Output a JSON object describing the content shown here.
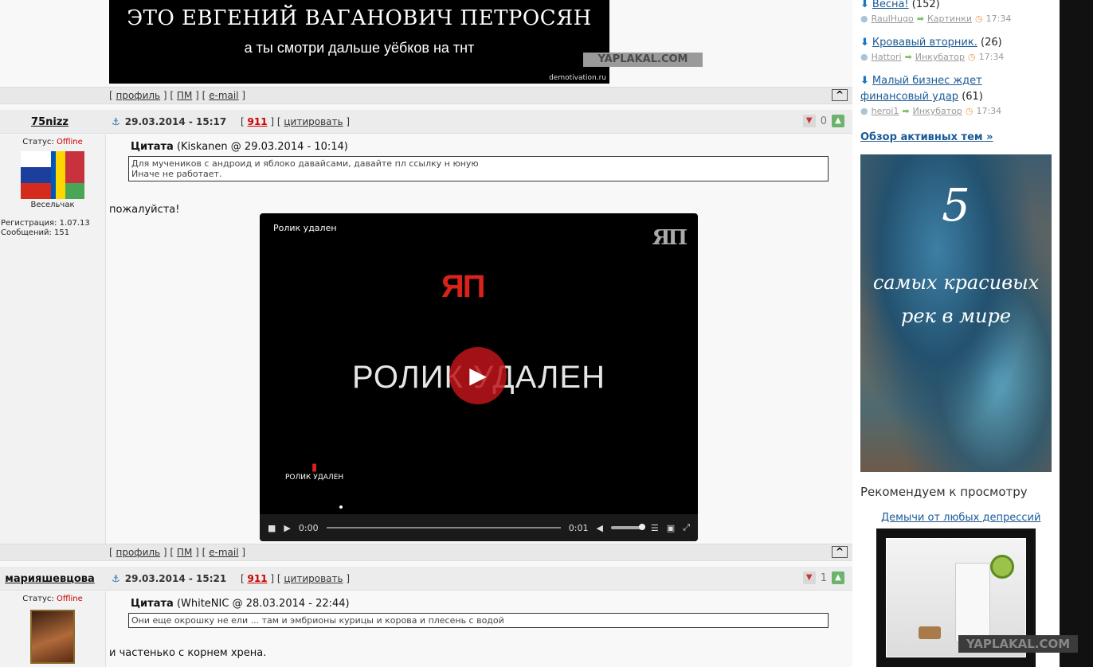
{
  "demotivator": {
    "line1": "ЭТО ЕВГЕНИЙ ВАГАНОВИЧ ПЕТРОСЯН",
    "line2": "а ты смотри дальше уёбков на тнт",
    "watermark": "YAPLAKAL.COM",
    "source": "demotivation.ru"
  },
  "post_links": {
    "profile": "профиль",
    "pm": "ПМ",
    "email": "e-mail",
    "top": "^"
  },
  "posts": [
    {
      "nick": "75nizz",
      "anchor": "⚓",
      "date": "29.03.2014 - 15:17",
      "rating": "911",
      "quote_action": "цитировать",
      "votes": "0",
      "status_label": "Статус:",
      "status": "Offline",
      "rank": "Весельчак",
      "reg": "Регистрация: 1.07.13",
      "messages": "Сообщений: 151",
      "quote_title": "Цитата",
      "quote_src": "(Kiskanen @ 29.03.2014 - 10:14)",
      "quote_line1": "Для мучеников с андроид и яблоко давайсами, давайте пл ссылку н юную",
      "quote_line2": "Иначе не работает.",
      "text": "пожалуйста!"
    },
    {
      "nick": "марияшевцова",
      "anchor": "⚓",
      "date": "29.03.2014 - 15:21",
      "rating": "911",
      "quote_action": "цитировать",
      "votes": "1",
      "status_label": "Статус:",
      "status": "Offline",
      "quote_title": "Цитата",
      "quote_src": "(WhiteNIC @ 28.03.2014 - 22:44)",
      "quote_line1": "Они еще окрошку не ели ... там и эмбрионы курицы и корова и плесень с водой",
      "text": "и частенько с корнем хрена."
    }
  ],
  "video": {
    "title": "Ролик удален",
    "corner_logo": "ЯП",
    "logo": "ЯП",
    "big_text": "РОЛИК УДАЛЕН",
    "small_caption": "РОЛИК УДАЛЕН",
    "time_current": "0:00",
    "time_total": "0:01"
  },
  "sidebar": {
    "topics": [
      {
        "title": "Весна!",
        "count": "(152)",
        "user": "RaulHugo",
        "section": "Картинки",
        "time": "17:34"
      },
      {
        "title": "Кровавый вторник.",
        "count": "(26)",
        "user": "Hattori",
        "section": "Инкубатор",
        "time": "17:34"
      },
      {
        "title": "Малый бизнес ждет финансовый удар",
        "count": "(61)",
        "user": "heroi1",
        "section": "Инкубатор",
        "time": "17:34"
      }
    ],
    "overview": "Обзор активных тем »",
    "banner_number": "5",
    "banner_line1": "самых красивых",
    "banner_line2": "рек в мире",
    "recommend_title": "Рекомендуем к просмотру",
    "recommend_link": "Демычи от любых депрессий",
    "watermark": "YAPLAKAL.COM"
  }
}
